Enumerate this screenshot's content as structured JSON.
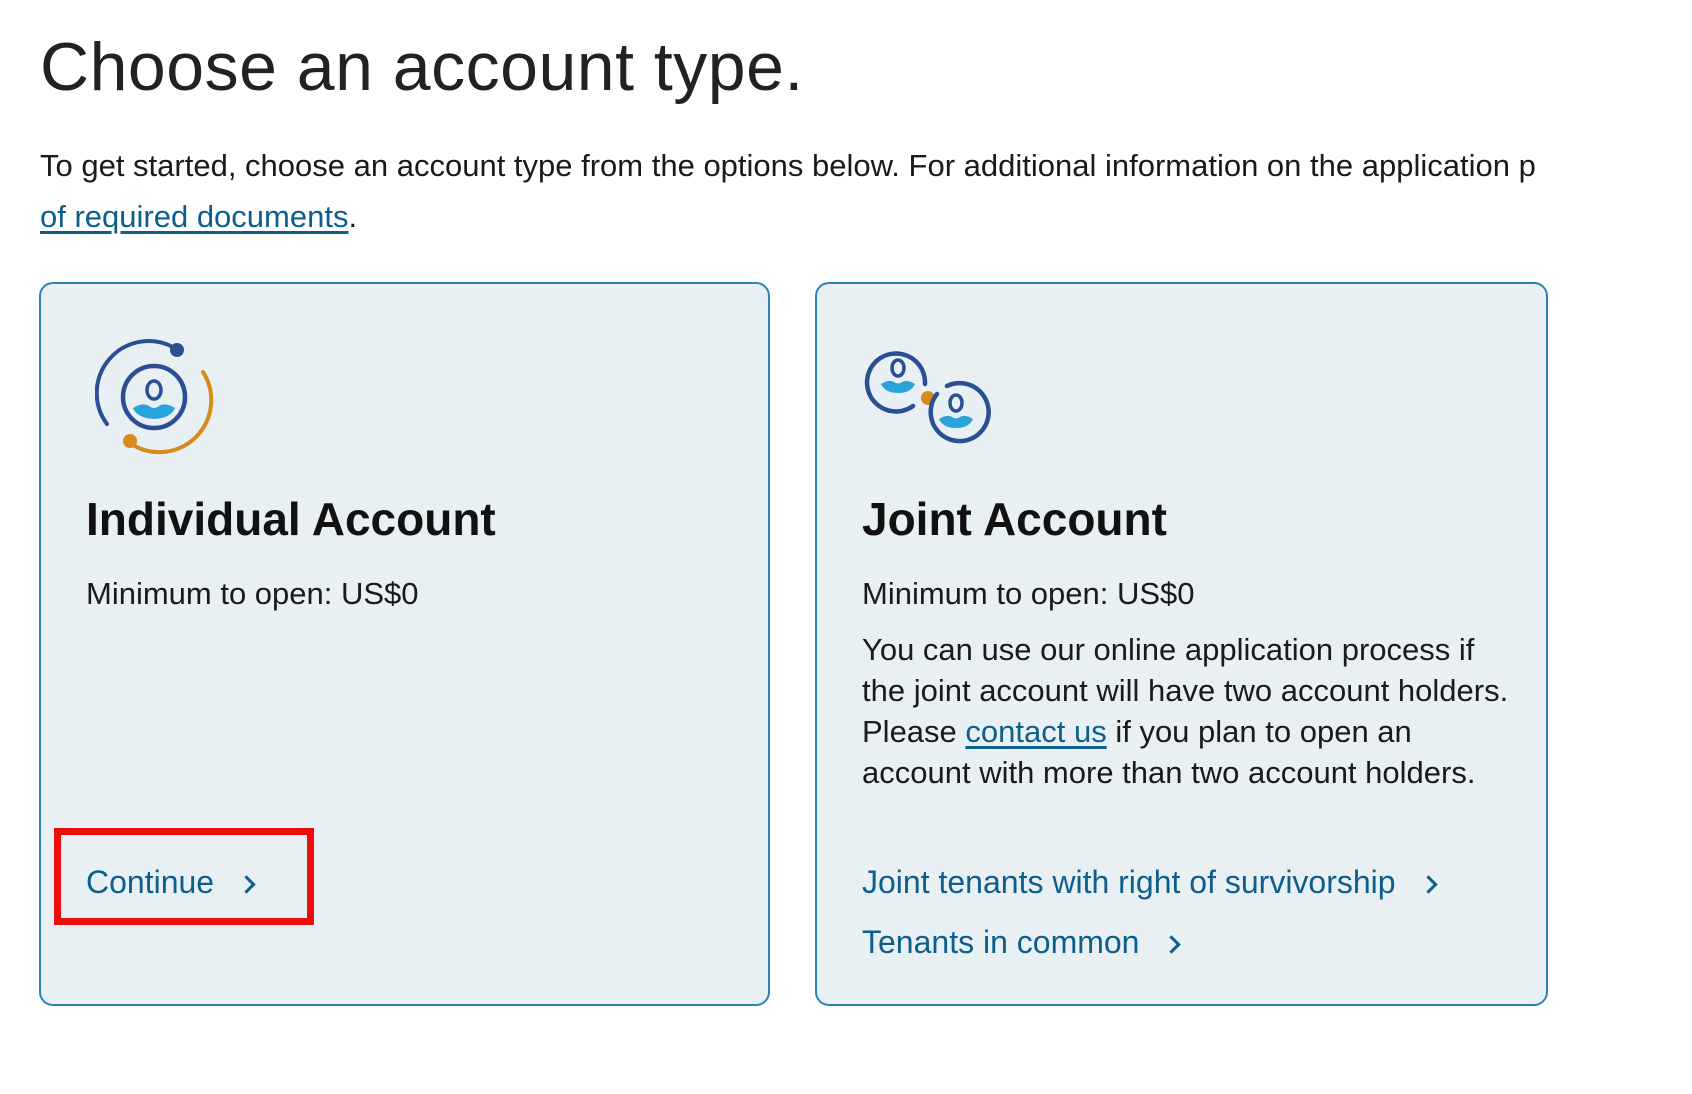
{
  "page": {
    "title": "Choose an account type.",
    "intro_text": "To get started, choose an account type from the options below. For additional information on the application p",
    "intro_link": "of required documents",
    "intro_after_link": "."
  },
  "cards": {
    "individual": {
      "icon": "individual-account-icon",
      "title": "Individual Account",
      "minimum": "Minimum to open: US$0",
      "continue_label": "Continue"
    },
    "joint": {
      "icon": "joint-account-icon",
      "title": "Joint Account",
      "minimum": "Minimum to open: US$0",
      "desc_before_link": "You can use our online application process if the joint account will have two account holders. Please ",
      "desc_link": "contact us",
      "desc_after_link": " if you plan to open an account with more than two account holders.",
      "links": [
        "Joint tenants with right of survivorship",
        "Tenants in common"
      ]
    }
  },
  "colors": {
    "link": "#0e5e8c",
    "card_background": "#e9f0f4",
    "card_border": "#2a83b9",
    "highlight": "#ee0d0d",
    "icon_navy": "#2b4f93",
    "icon_orange": "#d78a1e",
    "icon_cyan": "#2aa3db"
  }
}
